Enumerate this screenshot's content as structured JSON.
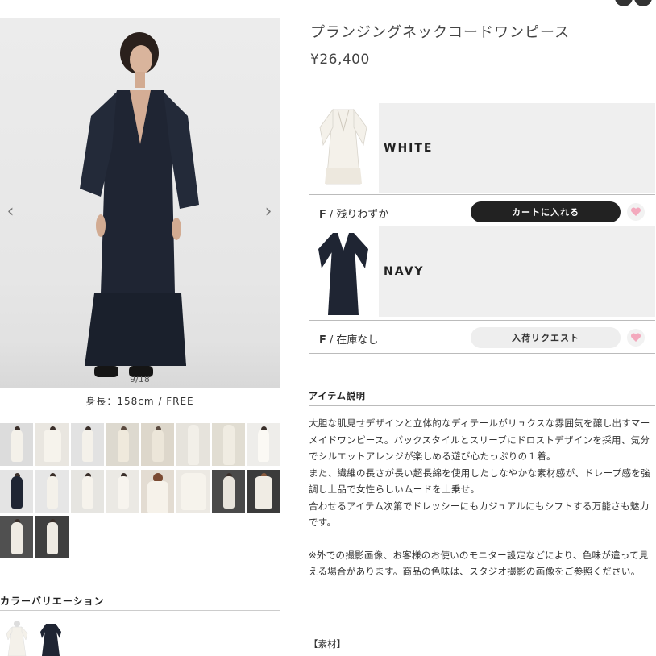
{
  "gallery": {
    "counter": "9/18",
    "caption": "身長：158cm / FREE",
    "prev_arrow": "‹",
    "next_arrow": "›"
  },
  "product": {
    "title": "プランジングネックコードワンピース",
    "price": "¥26,400"
  },
  "variants": [
    {
      "color": "WHITE",
      "size": "F",
      "stock": "残りわずか",
      "button": "カートに入れる"
    },
    {
      "color": "NAVY",
      "size": "F",
      "stock": "在庫なし",
      "button": "入荷リクエスト"
    }
  ],
  "description": {
    "heading": "アイテム説明",
    "paragraphs": [
      "大胆な肌見せデザインと立体的なディテールがリュクスな雰囲気を醸し出すマーメイドワンピース。バックスタイルとスリーブにドロストデザインを採用、気分でシルエットアレンジが楽しめる遊び心たっぷりの１着。",
      "また、繊維の長さが長い超長綿を使用したしなやかな素材感が、ドレープ感を強調し上品で女性らしいムードを上乗せ。",
      "合わせるアイテム次第でドレッシーにもカジュアルにもシフトする万能さも魅力です。",
      "※外での撮影画像、お客様のお使いのモニター設定などにより、色味が違って見える場合があります。商品の色味は、スタジオ撮影の画像をご参照ください。"
    ],
    "material_label": "【素材】"
  },
  "color_variation": {
    "heading": "カラーバリエーション"
  },
  "colors": {
    "navy": "#1f2533",
    "white": "#f4f1ea",
    "button_dark": "#222222",
    "fav_heart": "#f3a9bd"
  }
}
